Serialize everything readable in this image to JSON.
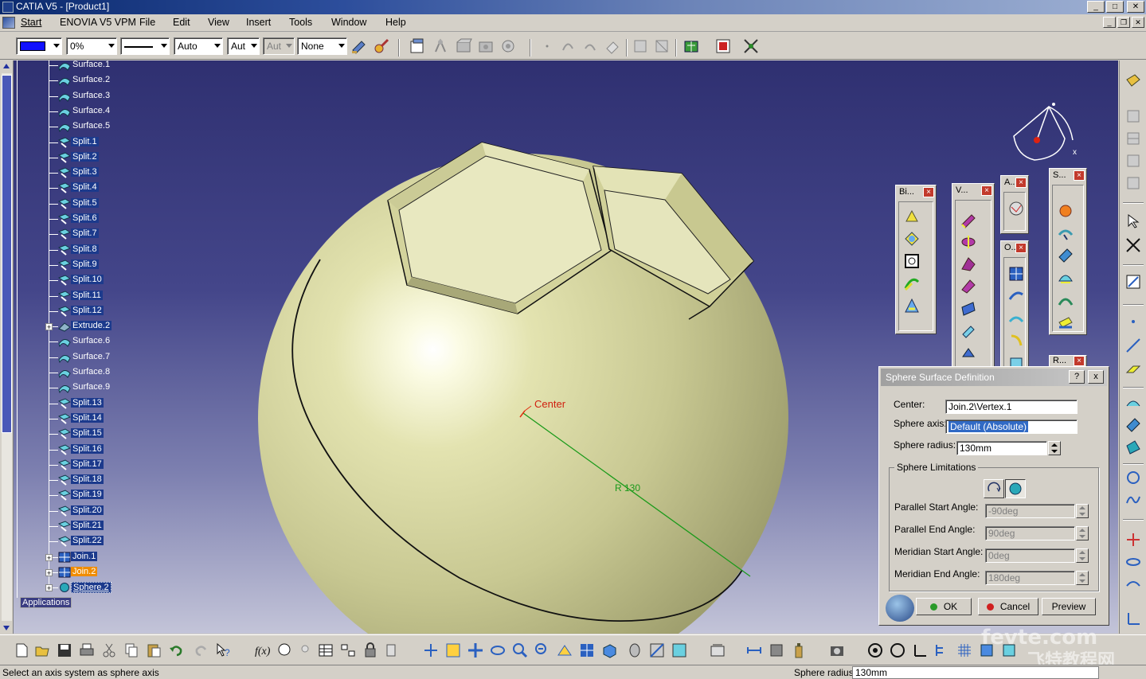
{
  "window": {
    "title": "CATIA V5 - [Product1]"
  },
  "menu": [
    "Start",
    "ENOVIA V5 VPM",
    "File",
    "Edit",
    "View",
    "Insert",
    "Tools",
    "Window",
    "Help"
  ],
  "toolbar": {
    "color_value": "#1010ff",
    "transparency": "0%",
    "thickness": "Auto",
    "linetype": "Aut",
    "point_type": "Aut",
    "layer": "None"
  },
  "tree": {
    "items": [
      {
        "label": "Surface.1",
        "type": "surface"
      },
      {
        "label": "Surface.2",
        "type": "surface"
      },
      {
        "label": "Surface.3",
        "type": "surface"
      },
      {
        "label": "Surface.4",
        "type": "surface"
      },
      {
        "label": "Surface.5",
        "type": "surface"
      },
      {
        "label": "Split.1",
        "type": "split"
      },
      {
        "label": "Split.2",
        "type": "split"
      },
      {
        "label": "Split.3",
        "type": "split"
      },
      {
        "label": "Split.4",
        "type": "split"
      },
      {
        "label": "Split.5",
        "type": "split"
      },
      {
        "label": "Split.6",
        "type": "split"
      },
      {
        "label": "Split.7",
        "type": "split"
      },
      {
        "label": "Split.8",
        "type": "split"
      },
      {
        "label": "Split.9",
        "type": "split"
      },
      {
        "label": "Split.10",
        "type": "split"
      },
      {
        "label": "Split.11",
        "type": "split"
      },
      {
        "label": "Split.12",
        "type": "split"
      },
      {
        "label": "Extrude.2",
        "type": "extrude"
      },
      {
        "label": "Surface.6",
        "type": "surface"
      },
      {
        "label": "Surface.7",
        "type": "surface"
      },
      {
        "label": "Surface.8",
        "type": "surface"
      },
      {
        "label": "Surface.9",
        "type": "surface"
      },
      {
        "label": "Split.13",
        "type": "split"
      },
      {
        "label": "Split.14",
        "type": "split"
      },
      {
        "label": "Split.15",
        "type": "split"
      },
      {
        "label": "Split.16",
        "type": "split"
      },
      {
        "label": "Split.17",
        "type": "split"
      },
      {
        "label": "Split.18",
        "type": "split"
      },
      {
        "label": "Split.19",
        "type": "split"
      },
      {
        "label": "Split.20",
        "type": "split"
      },
      {
        "label": "Split.21",
        "type": "split"
      },
      {
        "label": "Split.22",
        "type": "split"
      },
      {
        "label": "Join.1",
        "type": "join"
      },
      {
        "label": "Join.2",
        "type": "join"
      },
      {
        "label": "Sphere.2",
        "type": "sphere"
      }
    ],
    "applications_label": "Applications"
  },
  "viewport": {
    "center_label": "Center",
    "radius_label": "R 130"
  },
  "float_toolbars": [
    {
      "title": "Bi..."
    },
    {
      "title": "V..."
    },
    {
      "title": "A..."
    },
    {
      "title": "O..."
    },
    {
      "title": "S..."
    },
    {
      "title": "R..."
    }
  ],
  "dialog": {
    "title": "Sphere Surface Definition",
    "help_btn": "?",
    "close_btn": "x",
    "center_label": "Center:",
    "center_value": "Join.2\\Vertex.1",
    "axis_label": "Sphere axis:",
    "axis_value": "Default (Absolute)",
    "radius_label": "Sphere radius:",
    "radius_value": "130mm",
    "limits_title": "Sphere Limitations",
    "parallel_start_label": "Parallel Start Angle:",
    "parallel_start_value": "-90deg",
    "parallel_end_label": "Parallel End Angle:",
    "parallel_end_value": "90deg",
    "meridian_start_label": "Meridian Start Angle:",
    "meridian_start_value": "0deg",
    "meridian_end_label": "Meridian End Angle:",
    "meridian_end_value": "180deg",
    "ok": "OK",
    "cancel": "Cancel",
    "preview": "Preview"
  },
  "status": {
    "message": "Select an axis system as sphere axis",
    "param_label": "Sphere radius",
    "param_value": "130mm"
  },
  "watermark": {
    "line1": "fevte.com",
    "line2": "飞特教程网"
  },
  "colors": {
    "sphere": "#d6d6a0",
    "highlight": "#f08c00",
    "selection": "#1c3a8c"
  }
}
